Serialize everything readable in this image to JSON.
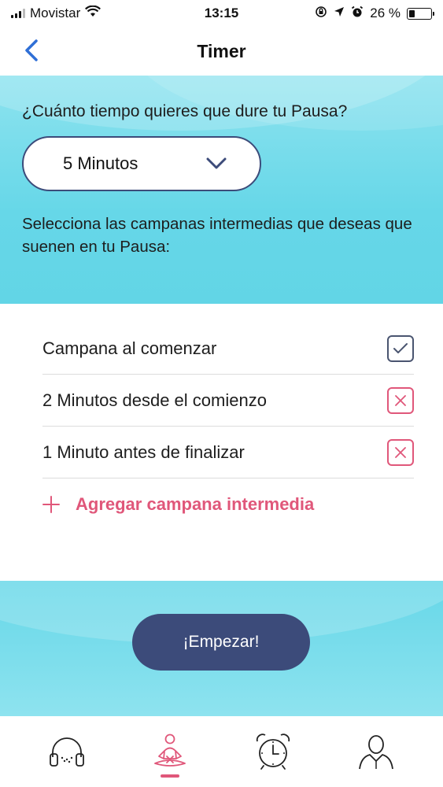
{
  "status_bar": {
    "carrier": "Movistar",
    "time": "13:15",
    "battery": "26 %",
    "battery_level": 0.26
  },
  "nav": {
    "title": "Timer"
  },
  "duration": {
    "prompt": "¿Cuánto tiempo quieres que dure tu Pausa?",
    "selected": "5 Minutos"
  },
  "bells": {
    "prompt": "Selecciona las campanas intermedias que deseas que suenen en tu Pausa:",
    "items": [
      {
        "label": "Campana al comenzar",
        "state": "checked"
      },
      {
        "label": "2 Minutos desde el comienzo",
        "state": "remove"
      },
      {
        "label": "1 Minuto antes de finalizar",
        "state": "remove"
      }
    ],
    "add_label": "Agregar campana intermedia"
  },
  "start_button": "¡Empezar!",
  "tabs": [
    {
      "icon": "headphones-icon",
      "active": false
    },
    {
      "icon": "meditation-icon",
      "active": true
    },
    {
      "icon": "alarm-clock-icon",
      "active": false
    },
    {
      "icon": "profile-icon",
      "active": false
    }
  ],
  "colors": {
    "accent": "#e0577a",
    "primary": "#3c4b7a",
    "teal": "#66d7e8"
  }
}
